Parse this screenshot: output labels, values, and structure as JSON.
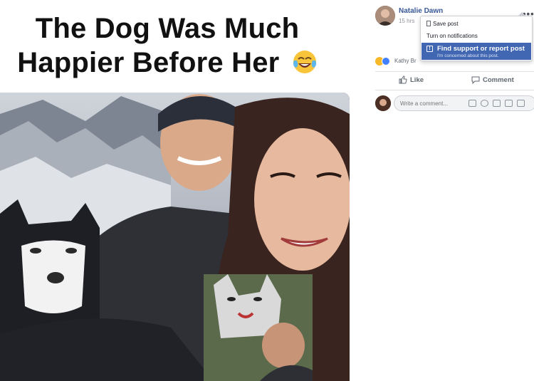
{
  "meme": {
    "line1": "The Dog Was Much",
    "line2": "Happier Before Her",
    "emoji": "laughing-crying-emoji"
  },
  "post": {
    "author_name": "Natalie Dawn",
    "timestamp": "15 hrs",
    "more_label": "•••",
    "reactions_text": "Kathy Br",
    "like_label": "Like",
    "comment_label": "Comment",
    "comment_placeholder": "Write a comment..."
  },
  "dropdown": {
    "save_label": "Save post",
    "notifications_label": "Turn on notifications",
    "report_label": "Find support or report post",
    "report_sub": "I'm concerned about this post."
  },
  "colors": {
    "brand": "#4267b2",
    "link": "#385898",
    "muted": "#90949c"
  }
}
